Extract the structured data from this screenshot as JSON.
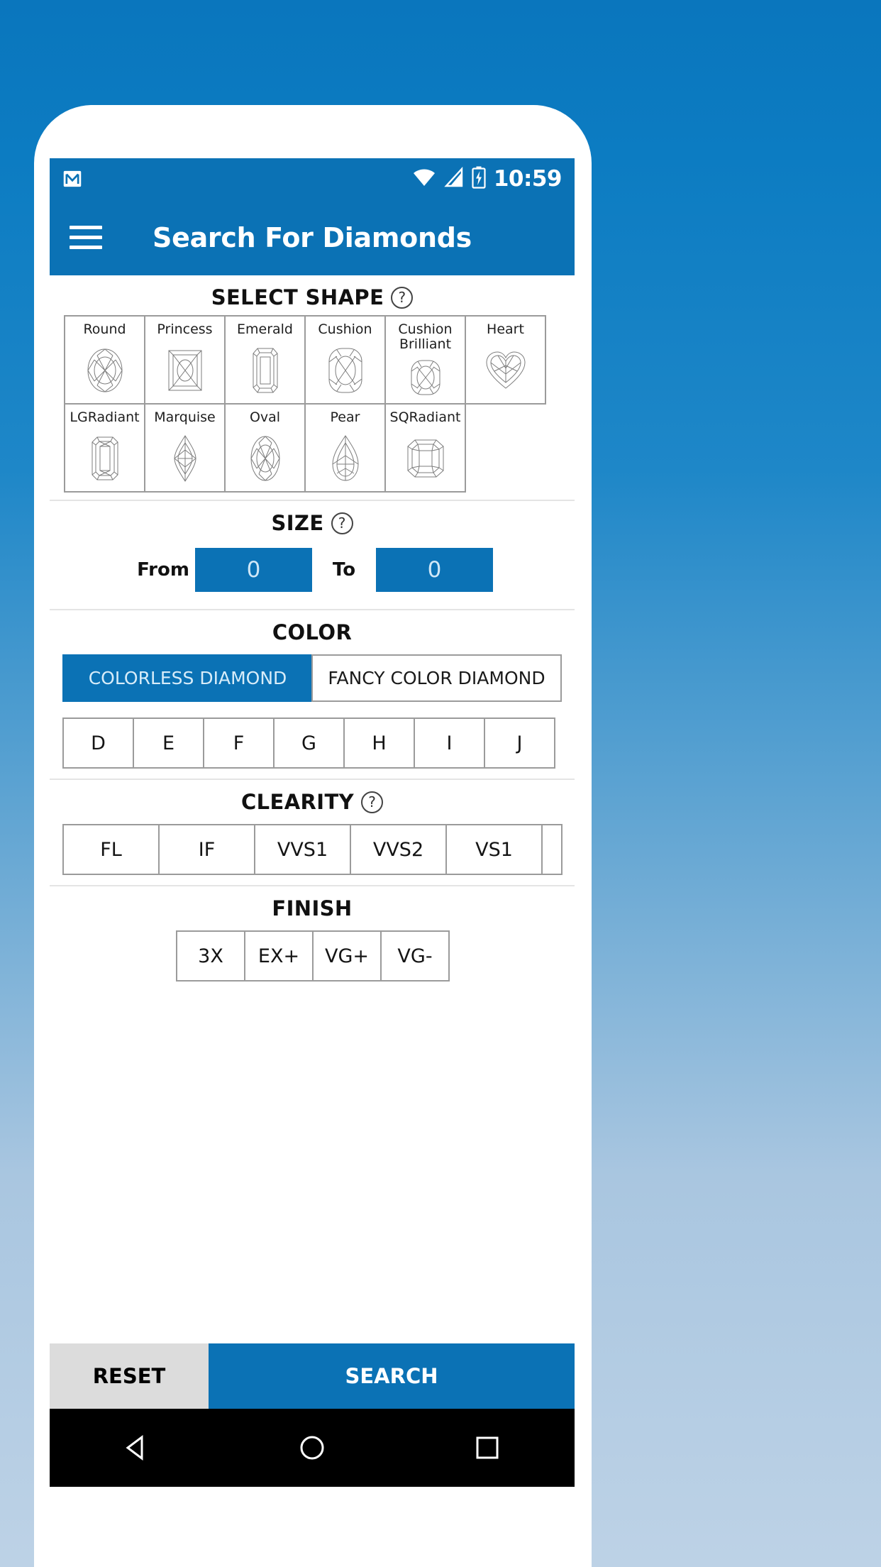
{
  "theme": {
    "brand_blue": "#0b72b5",
    "border_gray": "#9b9b9b",
    "reset_gray": "#dcdcdc",
    "divider_gray": "#e4e4e4"
  },
  "status_bar": {
    "notification_icon": "gmail-icon",
    "wifi_icon": "wifi-icon",
    "signal_icon": "cell-signal-icon",
    "battery_icon": "battery-charging-icon",
    "time": "10:59"
  },
  "app_bar": {
    "menu_icon": "hamburger-menu-icon",
    "title": "Search For Diamonds"
  },
  "sections": {
    "shape": {
      "title": "SELECT SHAPE",
      "help_icon": "question-mark-help-icon",
      "rows": [
        [
          {
            "label": "Round",
            "art": "round"
          },
          {
            "label": "Princess",
            "art": "princess"
          },
          {
            "label": "Emerald",
            "art": "emerald"
          },
          {
            "label": "Cushion",
            "art": "cushion"
          },
          {
            "label": "Cushion Brilliant",
            "art": "cushion-brilliant"
          },
          {
            "label": "Heart",
            "art": "heart"
          }
        ],
        [
          {
            "label": "LGRadiant",
            "art": "lgradiant"
          },
          {
            "label": "Marquise",
            "art": "marquise"
          },
          {
            "label": "Oval",
            "art": "oval"
          },
          {
            "label": "Pear",
            "art": "pear"
          },
          {
            "label": "SQRadiant",
            "art": "sqradiant"
          }
        ]
      ]
    },
    "size": {
      "title": "SIZE",
      "help_icon": "question-mark-help-icon",
      "from_label": "From",
      "from_value": "0",
      "from_placeholder": "0",
      "to_label": "To",
      "to_value": "0",
      "to_placeholder": "0"
    },
    "color": {
      "title": "COLOR",
      "toggles": [
        {
          "label": "COLORLESS DIAMOND",
          "selected": true
        },
        {
          "label": "FANCY COLOR DIAMOND",
          "selected": false
        }
      ],
      "grades": [
        "D",
        "E",
        "F",
        "G",
        "H",
        "I",
        "J"
      ]
    },
    "clarity": {
      "title": "CLEARITY",
      "help_icon": "question-mark-help-icon",
      "grades": [
        "FL",
        "IF",
        "VVS1",
        "VVS2",
        "VS1"
      ],
      "partial_cell": ""
    },
    "finish": {
      "title": "FINISH",
      "grades": [
        "3X",
        "EX+",
        "VG+",
        "VG-"
      ]
    }
  },
  "actions": {
    "reset_label": "RESET",
    "search_label": "SEARCH"
  },
  "nav_bar": {
    "back_icon": "back-triangle-icon",
    "home_icon": "home-circle-icon",
    "recents_icon": "recents-square-icon"
  }
}
